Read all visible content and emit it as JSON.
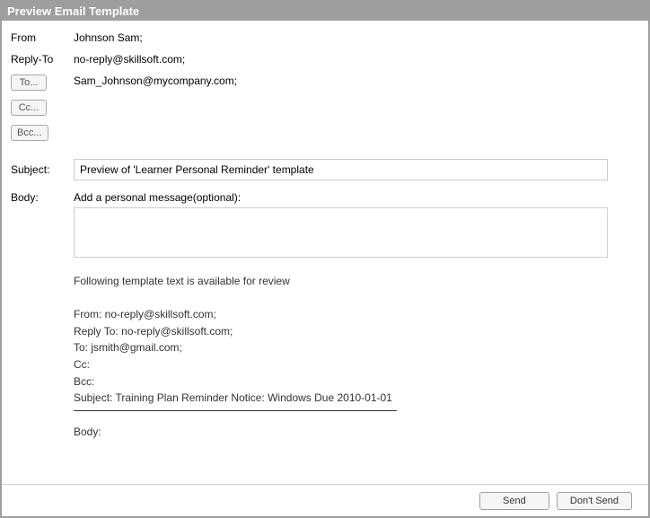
{
  "window": {
    "title": "Preview Email Template"
  },
  "labels": {
    "from": "From",
    "reply_to": "Reply-To",
    "to": "To...",
    "cc": "Cc...",
    "bcc": "Bcc...",
    "subject": "Subject:",
    "body": "Body:",
    "personal_message": "Add a personal message(optional):"
  },
  "fields": {
    "from": "Johnson Sam;",
    "reply_to": "no-reply@skillsoft.com;",
    "to": "Sam_Johnson@mycompany.com;",
    "cc": "",
    "bcc": "",
    "subject": "Preview of 'Learner Personal Reminder' template",
    "body": ""
  },
  "template_preview": {
    "intro": "Following template text is available for review",
    "from": "From: no-reply@skillsoft.com;",
    "reply_to": "Reply To: no-reply@skillsoft.com;",
    "to": "To: jsmith@gmail.com;",
    "cc": "Cc:",
    "bcc": "Bcc:",
    "subject": "Subject: Training Plan Reminder Notice: Windows Due 2010-01-01",
    "body_label": "Body:"
  },
  "footer": {
    "send": "Send",
    "dont_send": "Don't Send"
  }
}
